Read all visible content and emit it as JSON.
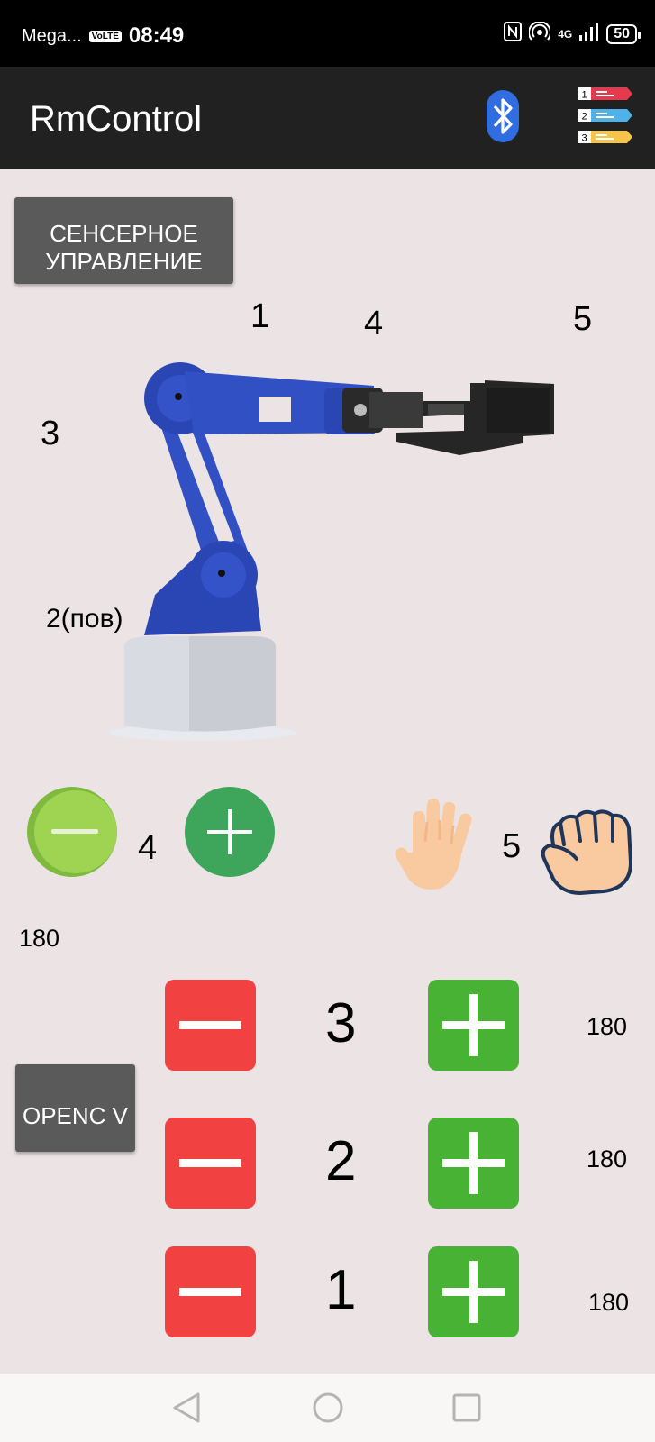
{
  "status_bar": {
    "carrier": "Mega...",
    "volte": "VoLTE",
    "time": "08:49",
    "network": "4G",
    "battery": "50"
  },
  "app_bar": {
    "title": "RmControl",
    "bluetooth_icon": "bluetooth-icon",
    "list_icon": "numbered-list-icon",
    "list_numbers": [
      "1",
      "2",
      "3"
    ]
  },
  "buttons": {
    "touch_control": "СЕНСЕРНОЕ УПРАВЛЕНИЕ",
    "opencv": "OPENC V"
  },
  "arm_labels": {
    "joint1": "1",
    "joint4": "4",
    "joint5": "5",
    "joint3": "3",
    "joint2": "2(пов)"
  },
  "joint4_control": {
    "label": "4",
    "minus_icon": "minus-circle-icon",
    "plus_icon": "plus-circle-icon"
  },
  "gripper_control": {
    "label": "5",
    "open_icon": "open-hand-icon",
    "close_icon": "fist-icon"
  },
  "value_left": "180",
  "joints": [
    {
      "label": "3",
      "value": "180"
    },
    {
      "label": "2",
      "value": "180"
    },
    {
      "label": "1",
      "value": "180"
    }
  ],
  "nav_bar": {
    "back": "back-icon",
    "home": "home-icon",
    "recents": "recents-icon"
  },
  "colors": {
    "app_bar": "#212121",
    "background": "#ece4e4",
    "red_button": "#f14141",
    "green_button": "#47b233",
    "arm_blue": "#2a46b5"
  }
}
